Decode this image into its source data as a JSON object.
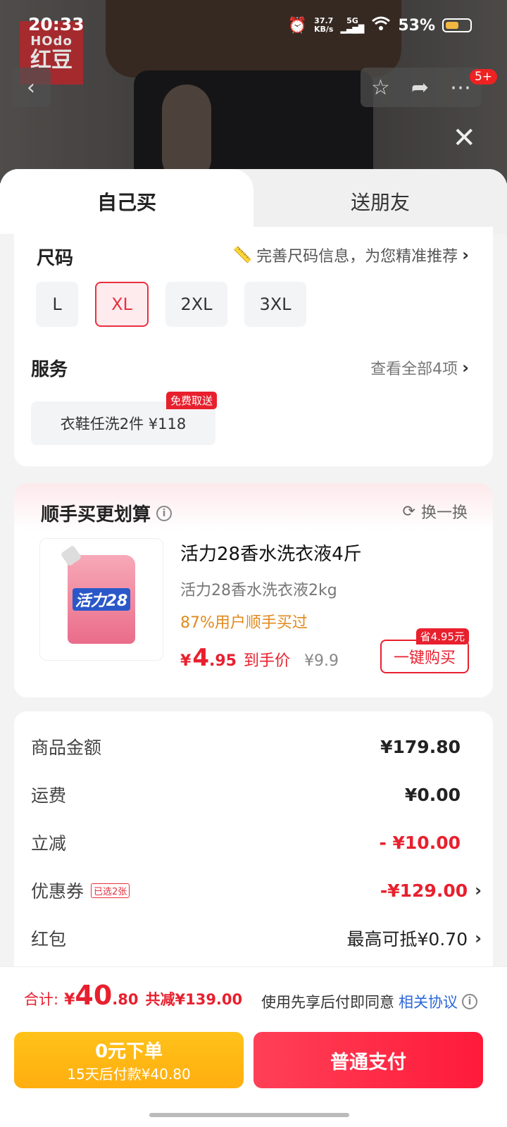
{
  "status": {
    "time": "20:33",
    "speed_top": "37.7",
    "speed_bottom": "KB/s",
    "network": "5G",
    "battery": "53%"
  },
  "header": {
    "logo_top": "HOdo",
    "logo_bottom": "红豆",
    "badge": "5+"
  },
  "tabs": {
    "self": "自己买",
    "gift": "送朋友"
  },
  "size": {
    "title": "尺码",
    "link": "完善尺码信息，为您精准推荐",
    "options": [
      "L",
      "XL",
      "2XL",
      "3XL"
    ],
    "selected": "XL"
  },
  "service": {
    "title": "服务",
    "link": "查看全部4项",
    "item": "衣鞋任洗2件  ¥118",
    "badge": "免费取送"
  },
  "deal": {
    "title": "顺手买更划算",
    "swap": "换一换",
    "product_name": "活力28香水洗衣液4斤",
    "product_spec": "活力28香水洗衣液2kg",
    "bought": "87%用户顺手买过",
    "pouch_text": "活力28",
    "price_currency": "¥",
    "price_int": "4",
    "price_dec": ".95",
    "price_label": "到手价",
    "price_orig": "¥9.9",
    "buy_button": "一键购买",
    "save_badge": "省4.95元"
  },
  "summary": {
    "goods_label": "商品金额",
    "goods_value": "¥179.80",
    "shipping_label": "运费",
    "shipping_value": "¥0.00",
    "discount_label": "立减",
    "discount_value": "- ¥10.00",
    "coupon_label": "优惠券",
    "coupon_tag": "已选2张",
    "coupon_value": "-¥129.00",
    "redpacket_label": "红包",
    "redpacket_value": "最高可抵¥0.70"
  },
  "footer": {
    "total_label": "合计:",
    "total_currency": "¥",
    "total_int": "40",
    "total_dec": ".80",
    "total_save": "共减¥139.00",
    "agree_text": "使用先享后付即同意",
    "agree_link": "相关协议",
    "later_line1": "0元下单",
    "later_line2": "15天后付款¥40.80",
    "pay_button": "普通支付"
  },
  "colors": {
    "accent": "#e8202e",
    "gold": "#ffb516",
    "link": "#2a66d9"
  }
}
